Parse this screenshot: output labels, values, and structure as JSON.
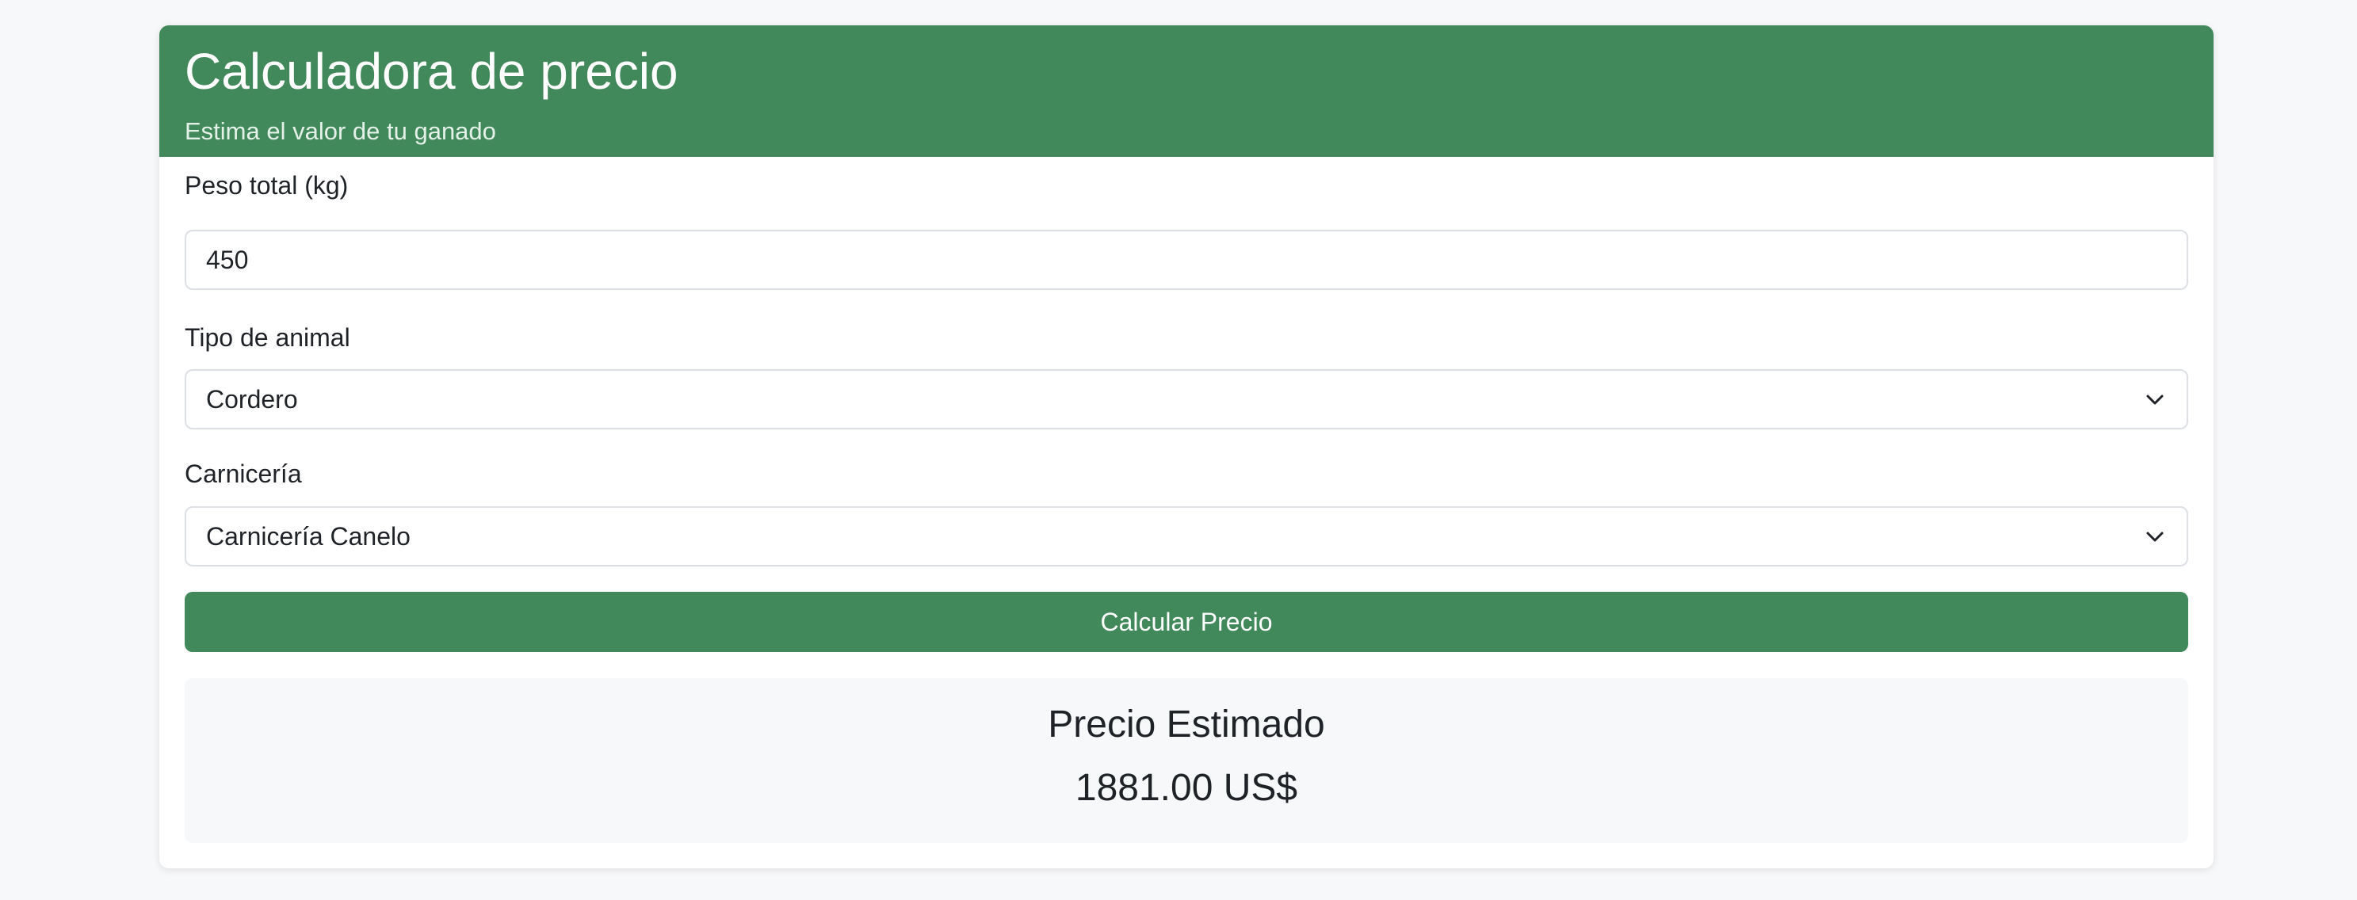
{
  "header": {
    "title": "Calculadora de precio",
    "subtitle": "Estima el valor de tu ganado"
  },
  "form": {
    "weight": {
      "label": "Peso total (kg)",
      "value": "450"
    },
    "animal_type": {
      "label": "Tipo de animal",
      "selected": "Cordero"
    },
    "butcher": {
      "label": "Carnicería",
      "selected": "Carnicería Canelo"
    },
    "submit_label": "Calcular Precio"
  },
  "result": {
    "title": "Precio Estimado",
    "value": "1881.00 US$"
  },
  "icons": {
    "select_arrow": "chevron-down-icon"
  },
  "colors": {
    "primary": "#41885a",
    "background": "#f7f8fa",
    "card": "#ffffff",
    "border": "#dcdfe4",
    "text": "#1f2328"
  }
}
